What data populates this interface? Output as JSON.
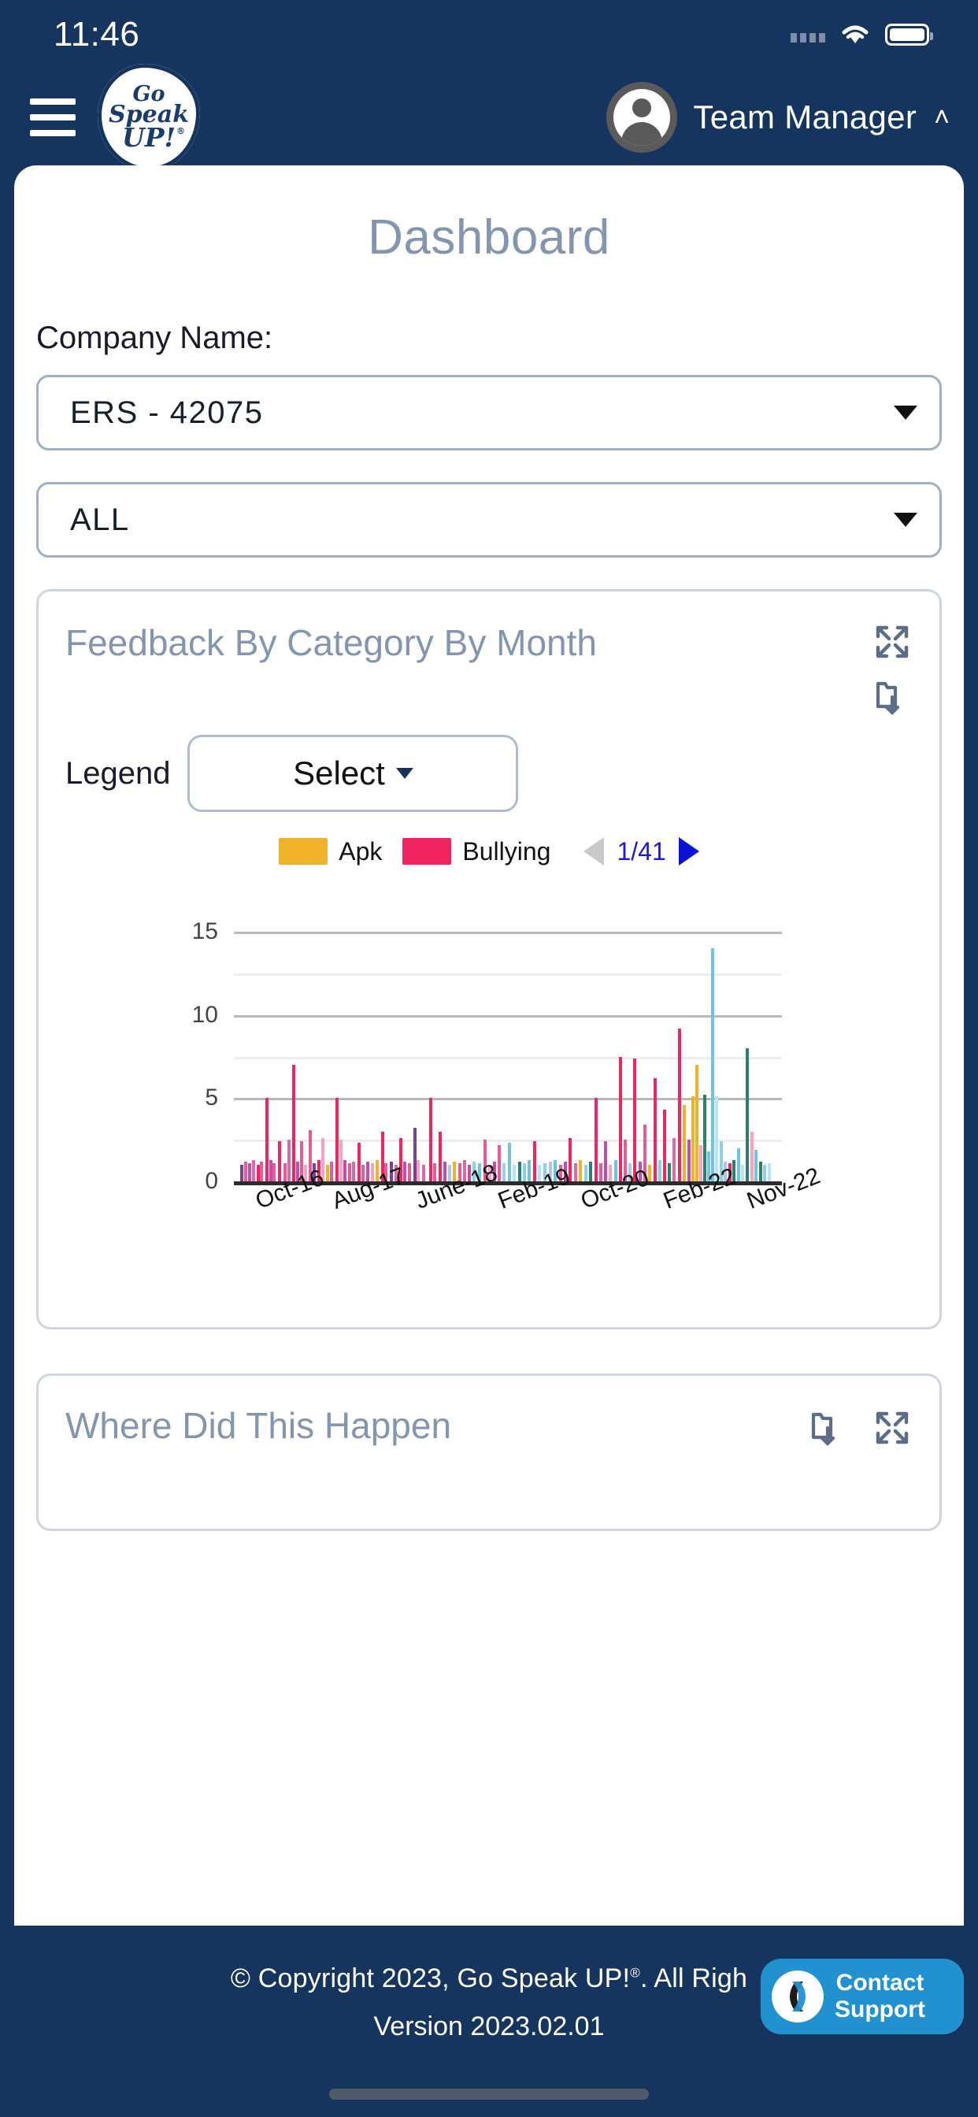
{
  "status_bar": {
    "time": "11:46",
    "icons": [
      "signal-dots-icon",
      "wifi-icon",
      "battery-icon"
    ]
  },
  "header": {
    "menu_icon": "hamburger-menu-icon",
    "logo": {
      "line1": "Go",
      "line2": "Speak",
      "line3": "UP!",
      "trademark": "®"
    },
    "user_name": "Team Manager",
    "chevron": "˄",
    "avatar_icon": "user-avatar-icon"
  },
  "page": {
    "title": "Dashboard",
    "company_label": "Company Name:",
    "company_value": "ERS - 42075",
    "scope_value": "ALL"
  },
  "feedback_card": {
    "title": "Feedback By Category By Month",
    "expand_icon": "expand-arrows-icon",
    "export_icon": "export-download-icon",
    "legend_label": "Legend",
    "legend_select_value": "Select"
  },
  "where_card": {
    "title": "Where Did This Happen",
    "export_icon": "export-download-icon",
    "expand_icon": "expand-arrows-icon"
  },
  "footer": {
    "copyright": "© Copyright 2023, Go Speak UP!",
    "copyright_mark": "®",
    "copyright_tail": ".   All Righ",
    "version": "Version 2023.02.01",
    "support_line1": "Contact",
    "support_line2": "Support",
    "support_icon": "support-chat-icon"
  },
  "colors": {
    "navy": "#16355E",
    "title_gray": "#8496ae",
    "apk": "#EFB229",
    "bullying": "#F0245E",
    "pager_blue": "#1a1ad8",
    "support_blue": "#2191d0"
  },
  "chart_data": {
    "type": "bar",
    "title": "Feedback By Category By Month",
    "xlabel": "",
    "ylabel": "",
    "ylim": [
      0,
      15
    ],
    "yticks": [
      0,
      5,
      10,
      15
    ],
    "minor_gridlines": [
      2.5,
      7.5,
      12.5
    ],
    "grid": true,
    "legend_position": "top",
    "pagination": {
      "current": 1,
      "total": 41,
      "text": "1/41"
    },
    "legend": [
      {
        "name": "Apk",
        "color": "#EFB229"
      },
      {
        "name": "Bullying",
        "color": "#F0245E"
      }
    ],
    "xtick_labels": [
      "Oct-16",
      "Aug-17",
      "June-18",
      "Feb-19",
      "Oct-20",
      "Feb-22",
      "Nov-22"
    ],
    "xtick_positions_pct": [
      3,
      16,
      30,
      44,
      58,
      72,
      86
    ],
    "palette": [
      "#F0245E",
      "#EFB229",
      "#E85A97",
      "#C04FA8",
      "#7B3FA0",
      "#F5A3C0",
      "#6FC5E0",
      "#2C7F6E",
      "#8FD0E8",
      "#B9E3F2",
      "#D86BA8",
      "#A8C8E8",
      "#E0457B",
      "#F07EB0"
    ],
    "bars": [
      {
        "x": 1.2,
        "y": 1.0,
        "c": "#7B3FA0"
      },
      {
        "x": 1.9,
        "y": 1.2,
        "c": "#E85A97"
      },
      {
        "x": 2.6,
        "y": 1.1,
        "c": "#C04FA8"
      },
      {
        "x": 3.3,
        "y": 1.3,
        "c": "#D86BA8"
      },
      {
        "x": 4.1,
        "y": 1.0,
        "c": "#F0245E"
      },
      {
        "x": 4.8,
        "y": 1.2,
        "c": "#E85A97"
      },
      {
        "x": 5.8,
        "y": 5.0,
        "c": "#F0245E"
      },
      {
        "x": 6.4,
        "y": 1.3,
        "c": "#C04FA8"
      },
      {
        "x": 7.1,
        "y": 1.1,
        "c": "#E85A97"
      },
      {
        "x": 8.0,
        "y": 2.4,
        "c": "#F0245E"
      },
      {
        "x": 9.0,
        "y": 1.1,
        "c": "#E85A97"
      },
      {
        "x": 9.8,
        "y": 2.5,
        "c": "#D86BA8"
      },
      {
        "x": 10.6,
        "y": 7.0,
        "c": "#F0245E"
      },
      {
        "x": 11.3,
        "y": 1.2,
        "c": "#C04FA8"
      },
      {
        "x": 12.0,
        "y": 2.4,
        "c": "#E85A97"
      },
      {
        "x": 12.8,
        "y": 1.0,
        "c": "#F5A3C0"
      },
      {
        "x": 13.6,
        "y": 3.1,
        "c": "#E85A97"
      },
      {
        "x": 14.3,
        "y": 1.1,
        "c": "#7B3FA0"
      },
      {
        "x": 15.2,
        "y": 1.3,
        "c": "#F0245E"
      },
      {
        "x": 16.0,
        "y": 2.6,
        "c": "#F5A3C0"
      },
      {
        "x": 16.8,
        "y": 1.0,
        "c": "#EFB229"
      },
      {
        "x": 17.6,
        "y": 1.2,
        "c": "#E85A97"
      },
      {
        "x": 18.6,
        "y": 5.0,
        "c": "#F0245E"
      },
      {
        "x": 19.2,
        "y": 2.5,
        "c": "#F5A3C0"
      },
      {
        "x": 19.9,
        "y": 1.3,
        "c": "#C04FA8"
      },
      {
        "x": 20.8,
        "y": 1.1,
        "c": "#E85A97"
      },
      {
        "x": 21.6,
        "y": 1.2,
        "c": "#D86BA8"
      },
      {
        "x": 22.5,
        "y": 2.3,
        "c": "#F0245E"
      },
      {
        "x": 23.3,
        "y": 1.0,
        "c": "#E85A97"
      },
      {
        "x": 24.2,
        "y": 1.2,
        "c": "#C04FA8"
      },
      {
        "x": 25.0,
        "y": 1.1,
        "c": "#F5A3C0"
      },
      {
        "x": 25.9,
        "y": 1.3,
        "c": "#EFB229"
      },
      {
        "x": 26.8,
        "y": 3.0,
        "c": "#F0245E"
      },
      {
        "x": 27.5,
        "y": 1.1,
        "c": "#E85A97"
      },
      {
        "x": 28.4,
        "y": 1.2,
        "c": "#7B3FA0"
      },
      {
        "x": 29.3,
        "y": 1.0,
        "c": "#D86BA8"
      },
      {
        "x": 30.2,
        "y": 2.6,
        "c": "#F0245E"
      },
      {
        "x": 30.9,
        "y": 1.2,
        "c": "#C04FA8"
      },
      {
        "x": 31.8,
        "y": 1.1,
        "c": "#E85A97"
      },
      {
        "x": 32.7,
        "y": 3.2,
        "c": "#7B3FA0"
      },
      {
        "x": 33.4,
        "y": 1.3,
        "c": "#F5A3C0"
      },
      {
        "x": 34.4,
        "y": 1.0,
        "c": "#D86BA8"
      },
      {
        "x": 35.6,
        "y": 5.0,
        "c": "#F0245E"
      },
      {
        "x": 36.4,
        "y": 1.1,
        "c": "#E85A97"
      },
      {
        "x": 37.4,
        "y": 3.0,
        "c": "#F0245E"
      },
      {
        "x": 38.2,
        "y": 1.2,
        "c": "#C04FA8"
      },
      {
        "x": 39.1,
        "y": 1.0,
        "c": "#A8C8E8"
      },
      {
        "x": 40.0,
        "y": 1.2,
        "c": "#EFB229"
      },
      {
        "x": 40.9,
        "y": 1.1,
        "c": "#E85A97"
      },
      {
        "x": 41.8,
        "y": 1.3,
        "c": "#D86BA8"
      },
      {
        "x": 42.7,
        "y": 1.0,
        "c": "#C04FA8"
      },
      {
        "x": 43.6,
        "y": 1.2,
        "c": "#8FD0E8"
      },
      {
        "x": 44.6,
        "y": 1.1,
        "c": "#6FC5E0"
      },
      {
        "x": 45.5,
        "y": 2.5,
        "c": "#E85A97"
      },
      {
        "x": 46.4,
        "y": 1.0,
        "c": "#F5A3C0"
      },
      {
        "x": 47.3,
        "y": 1.2,
        "c": "#C04FA8"
      },
      {
        "x": 48.2,
        "y": 2.2,
        "c": "#E85A97"
      },
      {
        "x": 49.0,
        "y": 1.1,
        "c": "#A8C8E8"
      },
      {
        "x": 50.0,
        "y": 2.3,
        "c": "#6FC5E0"
      },
      {
        "x": 50.9,
        "y": 1.0,
        "c": "#B9E3F2"
      },
      {
        "x": 51.8,
        "y": 1.2,
        "c": "#2C7F6E"
      },
      {
        "x": 52.7,
        "y": 1.1,
        "c": "#8FD0E8"
      },
      {
        "x": 53.6,
        "y": 1.3,
        "c": "#6FC5E0"
      },
      {
        "x": 54.6,
        "y": 2.4,
        "c": "#F0245E"
      },
      {
        "x": 55.5,
        "y": 1.0,
        "c": "#B9E3F2"
      },
      {
        "x": 56.4,
        "y": 1.1,
        "c": "#8FD0E8"
      },
      {
        "x": 57.4,
        "y": 1.2,
        "c": "#A8C8E8"
      },
      {
        "x": 58.4,
        "y": 1.3,
        "c": "#6FC5E0"
      },
      {
        "x": 59.3,
        "y": 1.0,
        "c": "#E85A97"
      },
      {
        "x": 60.2,
        "y": 1.2,
        "c": "#C04FA8"
      },
      {
        "x": 61.1,
        "y": 2.6,
        "c": "#F0245E"
      },
      {
        "x": 62.0,
        "y": 1.1,
        "c": "#D86BA8"
      },
      {
        "x": 63.0,
        "y": 1.3,
        "c": "#EFB229"
      },
      {
        "x": 63.9,
        "y": 1.0,
        "c": "#8FD0E8"
      },
      {
        "x": 64.8,
        "y": 1.2,
        "c": "#2C7F6E"
      },
      {
        "x": 65.8,
        "y": 5.0,
        "c": "#F0245E"
      },
      {
        "x": 66.6,
        "y": 1.1,
        "c": "#E85A97"
      },
      {
        "x": 67.5,
        "y": 2.4,
        "c": "#C04FA8"
      },
      {
        "x": 68.4,
        "y": 1.0,
        "c": "#F5A3C0"
      },
      {
        "x": 69.4,
        "y": 1.3,
        "c": "#6FC5E0"
      },
      {
        "x": 70.3,
        "y": 7.5,
        "c": "#F0245E"
      },
      {
        "x": 71.1,
        "y": 2.5,
        "c": "#E85A97"
      },
      {
        "x": 72.0,
        "y": 1.1,
        "c": "#A8C8E8"
      },
      {
        "x": 72.9,
        "y": 7.4,
        "c": "#F0245E"
      },
      {
        "x": 73.8,
        "y": 1.2,
        "c": "#C04FA8"
      },
      {
        "x": 74.7,
        "y": 3.4,
        "c": "#E85A97"
      },
      {
        "x": 75.6,
        "y": 1.0,
        "c": "#EFB229"
      },
      {
        "x": 76.6,
        "y": 6.2,
        "c": "#F0245E"
      },
      {
        "x": 77.4,
        "y": 1.3,
        "c": "#8FD0E8"
      },
      {
        "x": 78.3,
        "y": 4.3,
        "c": "#F0245E"
      },
      {
        "x": 79.2,
        "y": 1.1,
        "c": "#2C7F6E"
      },
      {
        "x": 80.1,
        "y": 2.6,
        "c": "#D86BA8"
      },
      {
        "x": 81.0,
        "y": 9.2,
        "c": "#F0245E"
      },
      {
        "x": 81.9,
        "y": 4.6,
        "c": "#EFB229"
      },
      {
        "x": 82.7,
        "y": 2.5,
        "c": "#C04FA8"
      },
      {
        "x": 83.5,
        "y": 5.1,
        "c": "#EFB229"
      },
      {
        "x": 84.2,
        "y": 7.0,
        "c": "#EFB229"
      },
      {
        "x": 84.9,
        "y": 2.2,
        "c": "#F5A3C0"
      },
      {
        "x": 85.6,
        "y": 5.2,
        "c": "#2C7F6E"
      },
      {
        "x": 86.3,
        "y": 1.8,
        "c": "#6FC5E0"
      },
      {
        "x": 87.0,
        "y": 14.0,
        "c": "#6FC5E0"
      },
      {
        "x": 87.8,
        "y": 5.1,
        "c": "#B9E3F2"
      },
      {
        "x": 88.6,
        "y": 2.4,
        "c": "#8FD0E8"
      },
      {
        "x": 89.4,
        "y": 1.2,
        "c": "#A8C8E8"
      },
      {
        "x": 90.2,
        "y": 1.1,
        "c": "#F0245E"
      },
      {
        "x": 91.0,
        "y": 1.3,
        "c": "#2C7F6E"
      },
      {
        "x": 91.8,
        "y": 2.0,
        "c": "#6FC5E0"
      },
      {
        "x": 92.6,
        "y": 1.0,
        "c": "#B9E3F2"
      },
      {
        "x": 93.4,
        "y": 8.0,
        "c": "#2C7F6E"
      },
      {
        "x": 94.2,
        "y": 3.0,
        "c": "#F5A3C0"
      },
      {
        "x": 95.0,
        "y": 1.9,
        "c": "#6FC5E0"
      },
      {
        "x": 95.8,
        "y": 1.2,
        "c": "#2C7F6E"
      },
      {
        "x": 96.6,
        "y": 1.0,
        "c": "#8FD0E8"
      },
      {
        "x": 97.4,
        "y": 1.1,
        "c": "#B9E3F2"
      }
    ]
  }
}
